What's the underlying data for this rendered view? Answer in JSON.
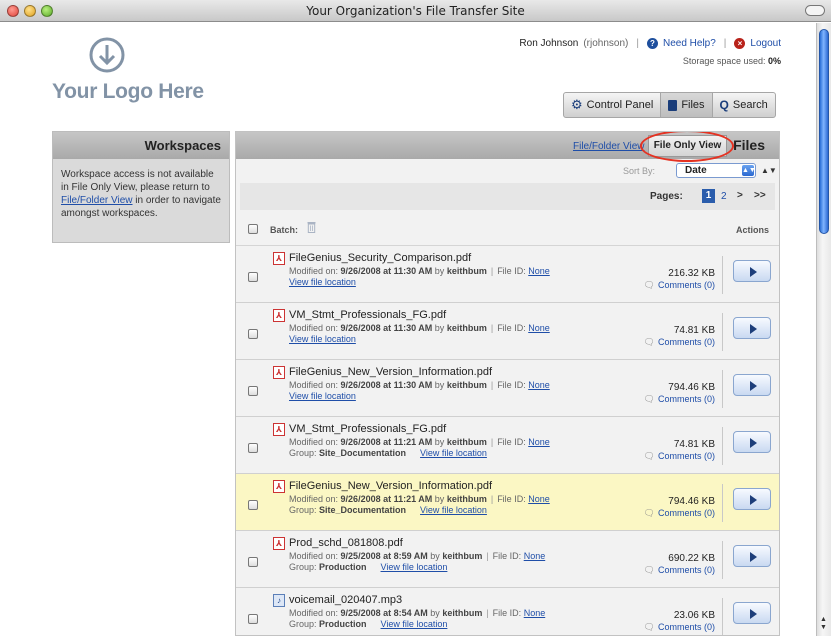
{
  "window": {
    "title": "Your Organization's File Transfer Site"
  },
  "logo": {
    "text": "Your Logo Here",
    "icon": "down-arrow-circle-icon"
  },
  "user": {
    "name": "Ron Johnson",
    "username": "(rjohnson)",
    "help_label": "Need Help?",
    "logout_label": "Logout",
    "storage_label": "Storage space used:",
    "storage_value": "0%"
  },
  "nav": {
    "control_panel": "Control Panel",
    "files": "Files",
    "search": "Search"
  },
  "workspaces": {
    "title": "Workspaces",
    "message_pre": "Workspace access is not available in File Only View, please return to ",
    "message_link": "File/Folder View",
    "message_post": " in order to navigate amongst workspaces."
  },
  "files_panel": {
    "title": "Files",
    "view_folder": "File/Folder View",
    "view_file_only": "File Only View",
    "sort_label": "Sort By:",
    "sort_value": "Date",
    "pages_label": "Pages:",
    "page_current": "1",
    "page_2": "2",
    "page_next": ">",
    "page_last": ">>",
    "batch_label": "Batch:",
    "actions_label": "Actions"
  },
  "row_labels": {
    "modified_on": "Modified on:",
    "by": "by",
    "file_id": "File ID:",
    "group": "Group:",
    "view_location": "View file location"
  },
  "files": [
    {
      "name": "FileGenius_Security_Comparison.pdf",
      "type": "pdf",
      "date": "9/26/2008 at 11:30 AM",
      "user": "keithbum",
      "file_id": "None",
      "group": "",
      "size": "216.32 KB",
      "comments": "Comments (0)",
      "highlight": false
    },
    {
      "name": "VM_Stmt_Professionals_FG.pdf",
      "type": "pdf",
      "date": "9/26/2008 at 11:30 AM",
      "user": "keithbum",
      "file_id": "None",
      "group": "",
      "size": "74.81 KB",
      "comments": "Comments (0)",
      "highlight": false
    },
    {
      "name": "FileGenius_New_Version_Information.pdf",
      "type": "pdf",
      "date": "9/26/2008 at 11:30 AM",
      "user": "keithbum",
      "file_id": "None",
      "group": "",
      "size": "794.46 KB",
      "comments": "Comments (0)",
      "highlight": false
    },
    {
      "name": "VM_Stmt_Professionals_FG.pdf",
      "type": "pdf",
      "date": "9/26/2008 at 11:21 AM",
      "user": "keithbum",
      "file_id": "None",
      "group": "Site_Documentation",
      "size": "74.81 KB",
      "comments": "Comments (0)",
      "highlight": false
    },
    {
      "name": "FileGenius_New_Version_Information.pdf",
      "type": "pdf",
      "date": "9/26/2008 at 11:21 AM",
      "user": "keithbum",
      "file_id": "None",
      "group": "Site_Documentation",
      "size": "794.46 KB",
      "comments": "Comments (0)",
      "highlight": true
    },
    {
      "name": "Prod_schd_081808.pdf",
      "type": "pdf",
      "date": "9/25/2008 at 8:59 AM",
      "user": "keithbum",
      "file_id": "None",
      "group": "Production",
      "size": "690.22 KB",
      "comments": "Comments (0)",
      "highlight": false
    },
    {
      "name": "voicemail_020407.mp3",
      "type": "mp3",
      "date": "9/25/2008 at 8:54 AM",
      "user": "keithbum",
      "file_id": "None",
      "group": "Production",
      "size": "23.06 KB",
      "comments": "Comments (0)",
      "highlight": false
    }
  ],
  "colors": {
    "accent": "#1f4ea8",
    "highlight_row": "#fbf7c4",
    "annotation_oval": "#e53222",
    "logo": "#8293a6"
  }
}
